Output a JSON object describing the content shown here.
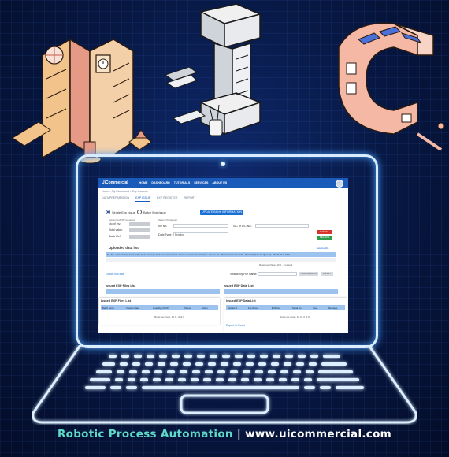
{
  "footer": {
    "tagline": "Robotic Process Automation",
    "separator": "|",
    "url": "www.uicommercial.com"
  },
  "app": {
    "logo": "UiCommercial",
    "nav": [
      "HOME",
      "DASHBOARD",
      "TUTORIALS",
      "SERVICES",
      "ABOUT US"
    ],
    "breadcrumb": "Home > My Dashboard > Exp Issuance",
    "tabs": [
      "DATA PREPARATION",
      "EXP ISSUE",
      "EXP REGISTER",
      "REPORT"
    ],
    "active_tab": "EXP ISSUE"
  },
  "form": {
    "radio_single": "Single Exp Issue",
    "radio_batch": "Batch Exp Issue",
    "update_button": "UPDATE BANK INFORMATION",
    "existing_label": "Existing Ic/EXP Issuance",
    "search_label": "Search Parameter",
    "no_of_inv": "No of Inv.",
    "total_value": "Total value.",
    "bank_ref": "Bank Ref.",
    "inv_no": "Inv No.",
    "lc_no": "S/C or L/C No.:",
    "date_type": "Date Type:",
    "date_type_value": "Pending",
    "cancel": "CANCEL",
    "search": "SEARCH"
  },
  "uploaded": {
    "title": "Uploaded data list",
    "selected": "Selected(0)",
    "columns": [
      "SL. No",
      "Uploaded Id",
      "Commodity Code",
      "Country Code",
      "Incoterm Used",
      "Invoice Amount",
      "Invoice Date",
      "Invoice No",
      "Master LC/Contract No",
      "Port of Shipment",
      "Quantity",
      "Month",
      "S to Alt-C"
    ],
    "rows_per_page": "Rows per Page:",
    "rows_value": "10",
    "range": "0 - 0",
    "page": "page 1",
    "export": "Export to Excel",
    "search_by": "Search by File Name:",
    "file_search": "FILE SEARCH",
    "reset": "RESET"
  },
  "issued_files": {
    "title": "Issued EXP Files List",
    "columns": [
      "Batch name",
      "Creation date",
      "Quantity of EXP",
      "Status",
      "Action"
    ],
    "rows_per_page": "Rows per page:",
    "rows_value": "10",
    "range": "0 - 0 of 0"
  },
  "issued_data": {
    "title": "Issued EXP Data List",
    "columns": [
      "Upload Id",
      "File Name",
      "EXP No.",
      "Serial No",
      "Year",
      "Message"
    ],
    "rows_per_page": "Rows per page:",
    "rows_value": "10",
    "range": "0 - 0 of 0",
    "export": "Export to Excel"
  }
}
